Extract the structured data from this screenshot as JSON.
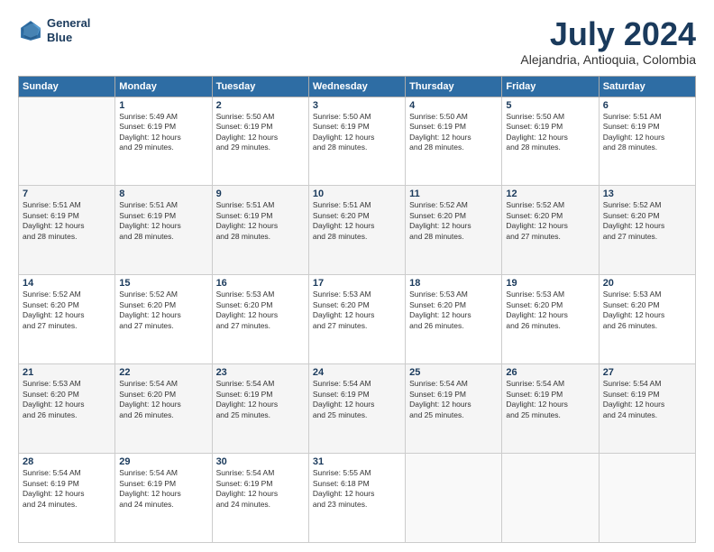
{
  "header": {
    "logo_line1": "General",
    "logo_line2": "Blue",
    "month_title": "July 2024",
    "location": "Alejandria, Antioquia, Colombia"
  },
  "days_of_week": [
    "Sunday",
    "Monday",
    "Tuesday",
    "Wednesday",
    "Thursday",
    "Friday",
    "Saturday"
  ],
  "weeks": [
    [
      {
        "day": "",
        "info": ""
      },
      {
        "day": "1",
        "info": "Sunrise: 5:49 AM\nSunset: 6:19 PM\nDaylight: 12 hours\nand 29 minutes."
      },
      {
        "day": "2",
        "info": "Sunrise: 5:50 AM\nSunset: 6:19 PM\nDaylight: 12 hours\nand 29 minutes."
      },
      {
        "day": "3",
        "info": "Sunrise: 5:50 AM\nSunset: 6:19 PM\nDaylight: 12 hours\nand 28 minutes."
      },
      {
        "day": "4",
        "info": "Sunrise: 5:50 AM\nSunset: 6:19 PM\nDaylight: 12 hours\nand 28 minutes."
      },
      {
        "day": "5",
        "info": "Sunrise: 5:50 AM\nSunset: 6:19 PM\nDaylight: 12 hours\nand 28 minutes."
      },
      {
        "day": "6",
        "info": "Sunrise: 5:51 AM\nSunset: 6:19 PM\nDaylight: 12 hours\nand 28 minutes."
      }
    ],
    [
      {
        "day": "7",
        "info": "Sunrise: 5:51 AM\nSunset: 6:19 PM\nDaylight: 12 hours\nand 28 minutes."
      },
      {
        "day": "8",
        "info": "Sunrise: 5:51 AM\nSunset: 6:19 PM\nDaylight: 12 hours\nand 28 minutes."
      },
      {
        "day": "9",
        "info": "Sunrise: 5:51 AM\nSunset: 6:19 PM\nDaylight: 12 hours\nand 28 minutes."
      },
      {
        "day": "10",
        "info": "Sunrise: 5:51 AM\nSunset: 6:20 PM\nDaylight: 12 hours\nand 28 minutes."
      },
      {
        "day": "11",
        "info": "Sunrise: 5:52 AM\nSunset: 6:20 PM\nDaylight: 12 hours\nand 28 minutes."
      },
      {
        "day": "12",
        "info": "Sunrise: 5:52 AM\nSunset: 6:20 PM\nDaylight: 12 hours\nand 27 minutes."
      },
      {
        "day": "13",
        "info": "Sunrise: 5:52 AM\nSunset: 6:20 PM\nDaylight: 12 hours\nand 27 minutes."
      }
    ],
    [
      {
        "day": "14",
        "info": "Sunrise: 5:52 AM\nSunset: 6:20 PM\nDaylight: 12 hours\nand 27 minutes."
      },
      {
        "day": "15",
        "info": "Sunrise: 5:52 AM\nSunset: 6:20 PM\nDaylight: 12 hours\nand 27 minutes."
      },
      {
        "day": "16",
        "info": "Sunrise: 5:53 AM\nSunset: 6:20 PM\nDaylight: 12 hours\nand 27 minutes."
      },
      {
        "day": "17",
        "info": "Sunrise: 5:53 AM\nSunset: 6:20 PM\nDaylight: 12 hours\nand 27 minutes."
      },
      {
        "day": "18",
        "info": "Sunrise: 5:53 AM\nSunset: 6:20 PM\nDaylight: 12 hours\nand 26 minutes."
      },
      {
        "day": "19",
        "info": "Sunrise: 5:53 AM\nSunset: 6:20 PM\nDaylight: 12 hours\nand 26 minutes."
      },
      {
        "day": "20",
        "info": "Sunrise: 5:53 AM\nSunset: 6:20 PM\nDaylight: 12 hours\nand 26 minutes."
      }
    ],
    [
      {
        "day": "21",
        "info": "Sunrise: 5:53 AM\nSunset: 6:20 PM\nDaylight: 12 hours\nand 26 minutes."
      },
      {
        "day": "22",
        "info": "Sunrise: 5:54 AM\nSunset: 6:20 PM\nDaylight: 12 hours\nand 26 minutes."
      },
      {
        "day": "23",
        "info": "Sunrise: 5:54 AM\nSunset: 6:19 PM\nDaylight: 12 hours\nand 25 minutes."
      },
      {
        "day": "24",
        "info": "Sunrise: 5:54 AM\nSunset: 6:19 PM\nDaylight: 12 hours\nand 25 minutes."
      },
      {
        "day": "25",
        "info": "Sunrise: 5:54 AM\nSunset: 6:19 PM\nDaylight: 12 hours\nand 25 minutes."
      },
      {
        "day": "26",
        "info": "Sunrise: 5:54 AM\nSunset: 6:19 PM\nDaylight: 12 hours\nand 25 minutes."
      },
      {
        "day": "27",
        "info": "Sunrise: 5:54 AM\nSunset: 6:19 PM\nDaylight: 12 hours\nand 24 minutes."
      }
    ],
    [
      {
        "day": "28",
        "info": "Sunrise: 5:54 AM\nSunset: 6:19 PM\nDaylight: 12 hours\nand 24 minutes."
      },
      {
        "day": "29",
        "info": "Sunrise: 5:54 AM\nSunset: 6:19 PM\nDaylight: 12 hours\nand 24 minutes."
      },
      {
        "day": "30",
        "info": "Sunrise: 5:54 AM\nSunset: 6:19 PM\nDaylight: 12 hours\nand 24 minutes."
      },
      {
        "day": "31",
        "info": "Sunrise: 5:55 AM\nSunset: 6:18 PM\nDaylight: 12 hours\nand 23 minutes."
      },
      {
        "day": "",
        "info": ""
      },
      {
        "day": "",
        "info": ""
      },
      {
        "day": "",
        "info": ""
      }
    ]
  ]
}
